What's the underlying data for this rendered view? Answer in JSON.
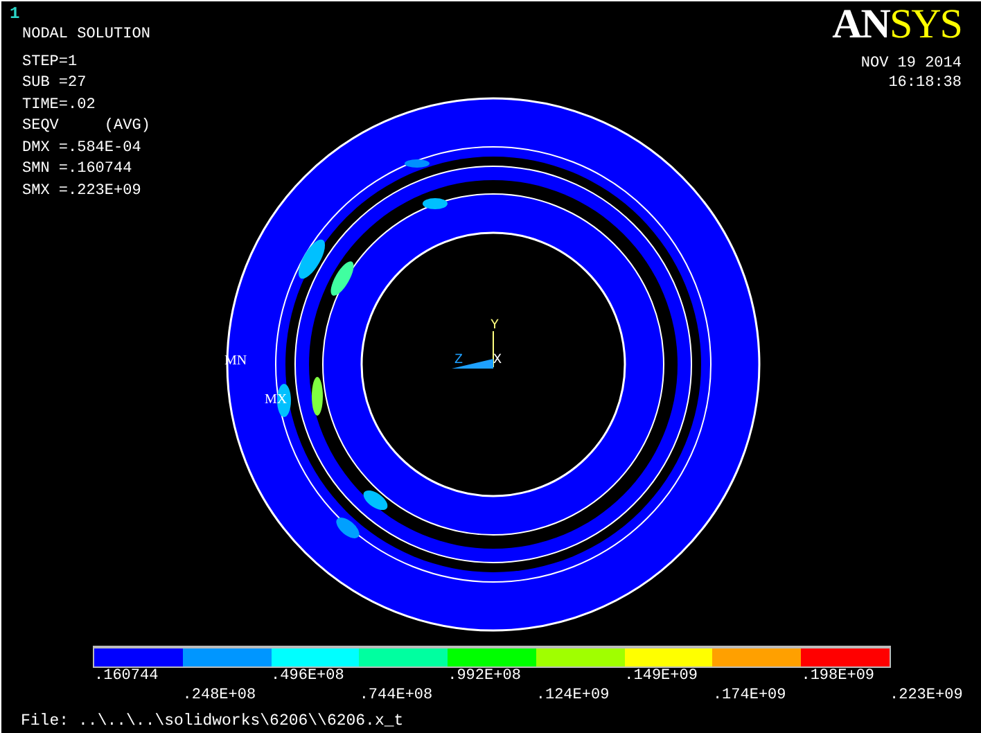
{
  "window": {
    "number": "1"
  },
  "info": {
    "title": "NODAL SOLUTION",
    "lines": [
      "STEP=1",
      "SUB =27",
      "TIME=.02",
      "SEQV     (AVG)",
      "DMX =.584E-04",
      "SMN =.160744",
      "SMX =.223E+09"
    ]
  },
  "logo": {
    "part_1": "AN",
    "part_2": "SYS"
  },
  "datetime": {
    "date": "NOV 19 2014",
    "time": "16:18:38"
  },
  "plot": {
    "min_label": "MN",
    "max_label": "MX",
    "axes": {
      "x": "X",
      "y": "Y",
      "z": "Z"
    }
  },
  "legend": {
    "bands": [
      {
        "color": "#0000ff"
      },
      {
        "color": "#0096ff"
      },
      {
        "color": "#00ffff"
      },
      {
        "color": "#00ffa0"
      },
      {
        "color": "#00ff00"
      },
      {
        "color": "#a0ff00"
      },
      {
        "color": "#ffff00"
      },
      {
        "color": "#ffa000"
      },
      {
        "color": "#ff0000"
      }
    ],
    "labels": [
      ".160744",
      ".248E+08",
      ".496E+08",
      ".744E+08",
      ".992E+08",
      ".124E+09",
      ".149E+09",
      ".174E+09",
      ".198E+09",
      ".223E+09"
    ]
  },
  "footer": {
    "label": "File:",
    "path": "..\\..\\..\\solidworks\\6206\\\\6206.x_t"
  }
}
